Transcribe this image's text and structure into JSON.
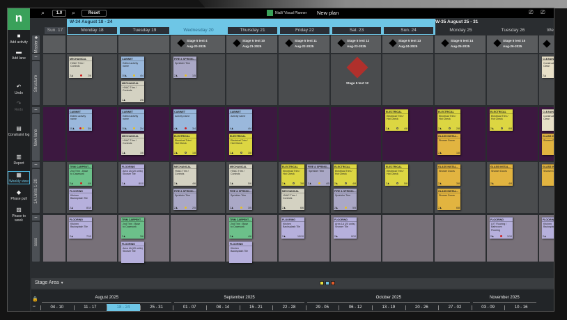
{
  "toolbar": {
    "zoom_value": "1.0",
    "reset_label": "Reset",
    "app_name": "Nialli' Visual Planner",
    "plan_name": "New plan",
    "zoom_out_icon": "zoom-out-icon",
    "zoom_in_icon": "zoom-in-icon"
  },
  "logo": "n",
  "sidebar": {
    "items": [
      {
        "label": "Add activity",
        "icon": "■"
      },
      {
        "label": "Add lane",
        "icon": "▬"
      },
      {
        "label": "Undo",
        "icon": "↶"
      },
      {
        "label": "Redo",
        "icon": "↷"
      },
      {
        "label": "Constraint log",
        "icon": "▤"
      },
      {
        "label": "Report",
        "icon": "▥"
      },
      {
        "label": "Weekly view",
        "icon": "▦"
      },
      {
        "label": "Phase pull",
        "icon": "◆"
      },
      {
        "label": "Phase to week",
        "icon": "▨"
      }
    ],
    "active": "Weekly view"
  },
  "weeks": [
    {
      "label": "W-34 August 18 - 24"
    },
    {
      "label": "W-35 August 25 - 31"
    }
  ],
  "days": [
    "Sun. 17",
    "Monday 18",
    "Tuesday 19",
    "Wednesday 20",
    "Thursday 21",
    "Friday 22",
    "Sat. 23",
    "Sun. 24",
    "Monday 25",
    "Tuesday 26",
    "We"
  ],
  "current_day": "Wednesday 20",
  "lanes": [
    {
      "name": "Master"
    },
    {
      "name": "Structure"
    },
    {
      "name": "New lane"
    },
    {
      "name": "1A Units 1-20"
    },
    {
      "name": "ssss"
    }
  ],
  "milestones": [
    {
      "day": "Wednesday 20",
      "name": "Stage 5 test 4",
      "date": "Aug-20-2025"
    },
    {
      "day": "Thursday 21",
      "name": "Stage 5 test 10",
      "date": "Aug-21-2025"
    },
    {
      "day": "Friday 22",
      "name": "Stage 5 test 11",
      "date": "Aug-22-2025"
    },
    {
      "day": "Sat. 23",
      "name": "Stage 5 test 12",
      "date": "Aug-23-2025"
    },
    {
      "day": "Sun. 24",
      "name": "Stage 5 test 13",
      "date": "Aug-24-2025"
    },
    {
      "day": "Monday 25",
      "name": "Stage 5 test 14",
      "date": "Aug-25-2025"
    },
    {
      "day": "Tuesday 26",
      "name": "Stage 5 test 15",
      "date": "Aug-26-2025"
    }
  ],
  "lane_milestone": {
    "lane": "Structure",
    "day": "Sat. 23",
    "label": "Stage 5 test 12",
    "color": "#b0302c"
  },
  "trade_colors": {
    "MECHANICAL": "#d4d2c2",
    "CABINET": "#9ab8dc",
    "FIRE & SPRINKL...": "#aaa8c6",
    "ELECTRICAL": "#dcd642",
    "TRIM CARPENT...": "#6cc08a",
    "FLOORING": "#b6b0dc",
    "GLASS INSTAL...": "#e2b440",
    "CLEANING": "#e8e0c8"
  },
  "dot_colors": {
    "red": "#d02020",
    "yellow": "#e8c020",
    "ring": "#666"
  },
  "cards": [
    {
      "lane": "Structure",
      "day": "Monday 18",
      "trade": "MECHANICAL",
      "name": "HVAC Trim / Controls",
      "crew": "2♟",
      "dots": [
        "red"
      ],
      "progress": "2/6"
    },
    {
      "lane": "Structure",
      "day": "Tuesday 19",
      "trade": "CABINET",
      "name": "Edited activity name",
      "crew": "10♟",
      "dots": [
        "yellow"
      ],
      "progress": "4/4"
    },
    {
      "lane": "Structure",
      "day": "Tuesday 19",
      "trade": "MECHANICAL",
      "name": "HVAC Trim / Controls",
      "crew": "2♟",
      "dots": [],
      "progress": "2/6"
    },
    {
      "lane": "Structure",
      "day": "Wednesday 20",
      "trade": "FIRE & SPRINKL...",
      "name": "Sprinkler Trim",
      "crew": "2♟",
      "dots": [
        "yellow"
      ],
      "progress": "1/5"
    },
    {
      "lane": "Structure",
      "day": "We",
      "trade": "CLEANING",
      "name": "Construction Clean",
      "crew": "2♟",
      "dots": [],
      "progress": ""
    },
    {
      "lane": "New lane",
      "day": "Monday 18",
      "trade": "CABINET",
      "name": "Edited activity name",
      "crew": "10♟",
      "dots": [
        "red",
        "yellow"
      ],
      "progress": "3/4"
    },
    {
      "lane": "New lane",
      "day": "Tuesday 19",
      "trade": "CABINET",
      "name": "Edited activity name",
      "crew": "10♟",
      "dots": [
        "yellow"
      ],
      "progress": "2/4"
    },
    {
      "lane": "New lane",
      "day": "Tuesday 19",
      "trade": "MECHANICAL",
      "name": "HVAC Trim / Controls",
      "crew": "2♟",
      "dots": [],
      "progress": "1/6"
    },
    {
      "lane": "New lane",
      "day": "Wednesday 20",
      "trade": "CABINET",
      "name": "Activity name",
      "crew": "4♟",
      "dots": [
        "red"
      ],
      "progress": "3/4"
    },
    {
      "lane": "New lane",
      "day": "Wednesday 20",
      "trade": "ELECTRICAL",
      "name": "Electrical Trim / Hot Check",
      "crew": "2♟",
      "dots": [
        "ring"
      ],
      "progress": "1/8"
    },
    {
      "lane": "New lane",
      "day": "Thursday 21",
      "trade": "CABINET",
      "name": "Activity name",
      "crew": "4♟",
      "dots": [],
      "progress": "4/4"
    },
    {
      "lane": "New lane",
      "day": "Thursday 21",
      "trade": "ELECTRICAL",
      "name": "Electrical Trim / Hot Check",
      "crew": "2♟",
      "dots": [
        "ring"
      ],
      "progress": "3/8"
    },
    {
      "lane": "New lane",
      "day": "Sun. 24",
      "trade": "ELECTRICAL",
      "name": "Electrical Trim / Hot Check",
      "crew": "2♟",
      "dots": [
        "ring"
      ],
      "progress": "4/8"
    },
    {
      "lane": "New lane",
      "day": "Monday 25",
      "trade": "ELECTRICAL",
      "name": "Electrical Trim / Hot Check",
      "crew": "2♟",
      "dots": [
        "ring"
      ],
      "progress": "2/8"
    },
    {
      "lane": "New lane",
      "day": "Monday 25",
      "trade": "GLASS INSTAL...",
      "name": "Shower Doors",
      "crew": "2♟",
      "dots": [],
      "progress": "1/8"
    },
    {
      "lane": "New lane",
      "day": "Tuesday 26",
      "trade": "ELECTRICAL",
      "name": "Electrical Trim / Hot Check",
      "crew": "2♟",
      "dots": [
        "ring"
      ],
      "progress": "8/8"
    },
    {
      "lane": "New lane",
      "day": "We",
      "trade": "CLEANING",
      "name": "Construction Clean",
      "crew": "",
      "dots": [],
      "progress": ""
    },
    {
      "lane": "New lane",
      "day": "We",
      "trade": "GLASS INSTAL...",
      "name": "Shower Doors",
      "crew": "",
      "dots": [],
      "progress": ""
    },
    {
      "lane": "1A Units 1-20",
      "day": "Monday 18",
      "trade": "TRIM CARPENT...",
      "name": "2nd Trim - Base to Casework",
      "crew": "2♟",
      "dots": [
        "red"
      ],
      "progress": "4/6"
    },
    {
      "lane": "1A Units 1-20",
      "day": "Monday 18",
      "trade": "FLOORING",
      "name": "Kitchen Backsplash Tile",
      "crew": "2♟",
      "dots": [],
      "progress": "8/10"
    },
    {
      "lane": "1A Units 1-20",
      "day": "Tuesday 19",
      "trade": "FLOORING",
      "name": "Area 1A (20 units) Shower Tile",
      "crew": "2♟",
      "dots": [],
      "progress": "8/10"
    },
    {
      "lane": "1A Units 1-20",
      "day": "Wednesday 20",
      "trade": "MECHANICAL",
      "name": "HVAC Trim / Controls",
      "crew": "2♟",
      "dots": [],
      "progress": "4/6"
    },
    {
      "lane": "1A Units 1-20",
      "day": "Wednesday 20",
      "trade": "FIRE & SPRINKL...",
      "name": "Sprinkler Trim",
      "crew": "2♟",
      "dots": [
        "yellow"
      ],
      "progress": "2/5"
    },
    {
      "lane": "1A Units 1-20",
      "day": "Thursday 21",
      "trade": "MECHANICAL",
      "name": "HVAC Trim / Controls",
      "crew": "2♟",
      "dots": [],
      "progress": "5/6"
    },
    {
      "lane": "1A Units 1-20",
      "day": "Thursday 21",
      "trade": "FIRE & SPRINKL...",
      "name": "Sprinkler Trim",
      "crew": "2♟",
      "dots": [
        "yellow"
      ],
      "progress": "3/5"
    },
    {
      "lane": "1A Units 1-20",
      "day": "Friday 22",
      "trade": "ELECTRICAL",
      "name": "Electrical Trim / Hot Check",
      "crew": "2♟",
      "dots": [
        "ring"
      ],
      "progress": "3/8"
    },
    {
      "lane": "1A Units 1-20",
      "day": "Friday 22",
      "trade": "MECHANICAL",
      "name": "HVAC Trim / Controls",
      "crew": "2♟",
      "dots": [],
      "progress": "6/6"
    },
    {
      "lane": "1A Units 1-20",
      "day": "Friday 22",
      "trade": "FIRE & SPRINKL...",
      "name": "Sprinkler Trim",
      "crew": "2♟",
      "dots": [
        "yellow"
      ],
      "progress": "4/5"
    },
    {
      "lane": "1A Units 1-20",
      "day": "Sat. 23",
      "trade": "ELECTRICAL",
      "name": "Electrical Trim / Hot Check",
      "crew": "2♟",
      "dots": [
        "ring"
      ],
      "progress": "4/8"
    },
    {
      "lane": "1A Units 1-20",
      "day": "Sat. 23",
      "trade": "FIRE & SPRINKL...",
      "name": "Sprinkler Trim",
      "crew": "2♟",
      "dots": [
        "yellow"
      ],
      "progress": "5/5"
    },
    {
      "lane": "1A Units 1-20",
      "day": "Sun. 24",
      "trade": "ELECTRICAL",
      "name": "Electrical Trim / Hot Check",
      "crew": "2♟",
      "dots": [
        "ring"
      ],
      "progress": "5/8"
    },
    {
      "lane": "1A Units 1-20",
      "day": "Monday 25",
      "trade": "GLASS INSTAL...",
      "name": "Shower Doors",
      "crew": "2♟",
      "dots": [],
      "progress": "3/8"
    },
    {
      "lane": "1A Units 1-20",
      "day": "Monday 25",
      "trade": "GLASS INSTAL...",
      "name": "Shower Doors",
      "crew": "2♟",
      "dots": [],
      "progress": "6/8"
    },
    {
      "lane": "1A Units 1-20",
      "day": "Tuesday 26",
      "trade": "GLASS INSTAL...",
      "name": "Shower Doors",
      "crew": "2♟",
      "dots": [],
      "progress": "4/8"
    },
    {
      "lane": "1A Units 1-20",
      "day": "We",
      "trade": "GLASS INSTAL...",
      "name": "Shower Doors",
      "crew": "",
      "dots": [],
      "progress": ""
    },
    {
      "lane": "ssss",
      "day": "Monday 18",
      "trade": "FLOORING",
      "name": "Kitchen Backsplash Tile",
      "crew": "2♟",
      "dots": [],
      "progress": "7/10"
    },
    {
      "lane": "ssss",
      "day": "Tuesday 19",
      "trade": "TRIM CARPENT...",
      "name": "2nd Trim : Base to Casework",
      "crew": "2♟",
      "dots": [],
      "progress": "3/6"
    },
    {
      "lane": "ssss",
      "day": "Tuesday 19",
      "trade": "FLOORING",
      "name": "Area 1A (20 units) Shower Tile",
      "crew": "",
      "dots": [],
      "progress": ""
    },
    {
      "lane": "ssss",
      "day": "Thursday 21",
      "trade": "TRIM CARPENT...",
      "name": "2nd Trim : Base to Casework",
      "crew": "2♟",
      "dots": [],
      "progress": "4/6"
    },
    {
      "lane": "ssss",
      "day": "Thursday 21",
      "trade": "FLOORING",
      "name": "Kitchen Backsplash Tile",
      "crew": "",
      "dots": [],
      "progress": ""
    },
    {
      "lane": "ssss",
      "day": "Friday 22",
      "trade": "FLOORING",
      "name": "Kitchen Backsplash Tile",
      "crew": "2♟",
      "dots": [],
      "progress": "10/10"
    },
    {
      "lane": "ssss",
      "day": "Sat. 23",
      "trade": "FLOORING",
      "name": "Area 1A (20 units) Shower Tile",
      "crew": "2♟",
      "dots": [],
      "progress": "9/10"
    },
    {
      "lane": "ssss",
      "day": "Tuesday 26",
      "trade": "FLOORING",
      "name": "LVT Flooring / Bathroom Flooring",
      "crew": "2♟",
      "dots": [
        "red"
      ],
      "progress": "1/10"
    },
    {
      "lane": "ssss",
      "day": "We",
      "trade": "FLOORING",
      "name": "Kitchen Backsplash Tile",
      "crew": "2♟",
      "dots": [],
      "progress": ""
    }
  ],
  "stage_area": {
    "label": "Stage Area",
    "swatches": [
      "#e8e040",
      "#6ec6e6",
      "#e05a2a"
    ]
  },
  "timeline": {
    "months": [
      "August 2025",
      "September 2025",
      "October 2025",
      "November 2025"
    ],
    "weeks": [
      "04 - 10",
      "11 - 17",
      "18 - 24",
      "25 - 31",
      "01 - 07",
      "08 - 14",
      "15 - 21",
      "22 - 28",
      "29 - 05",
      "06 - 12",
      "13 - 19",
      "20 - 26",
      "27 - 02",
      "03 - 09",
      "10 - 16"
    ],
    "active": "18 - 24"
  }
}
